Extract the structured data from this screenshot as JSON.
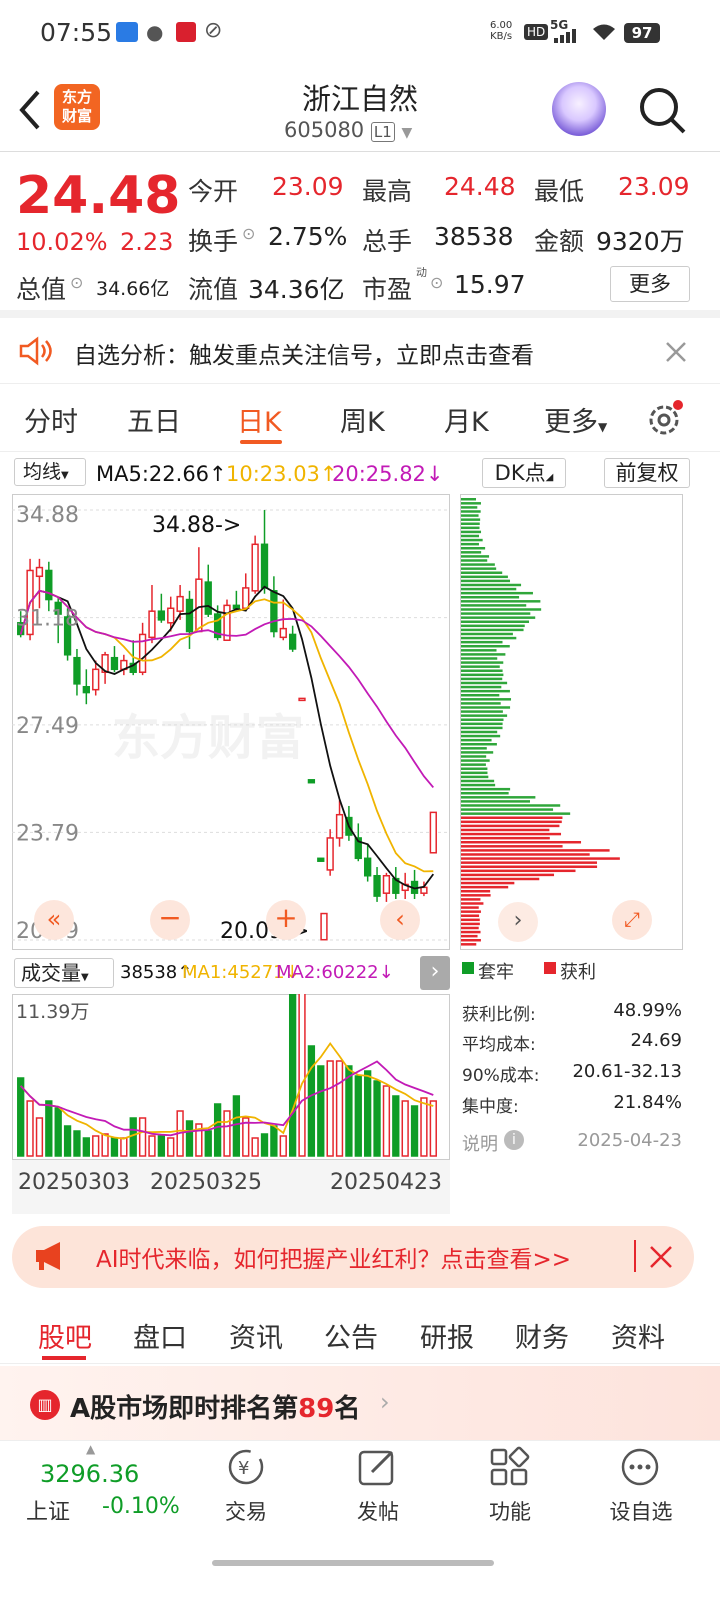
{
  "status": {
    "time": "07:55",
    "speed": "6.00",
    "speed_unit": "KB/s",
    "hd": "HD",
    "net": "5G",
    "battery": "97"
  },
  "header": {
    "title": "浙江自然",
    "code": "605080",
    "level": "L1",
    "logo_line1": "东方",
    "logo_line2": "财富"
  },
  "quote": {
    "price": "24.48",
    "change_pct": "10.02%",
    "change": "2.23",
    "open_label": "今开",
    "open": "23.09",
    "high_label": "最高",
    "high": "24.48",
    "low_label": "最低",
    "low": "23.09",
    "turnover_label": "换手",
    "turnover": "2.75%",
    "volume_label": "总手",
    "volume": "38538",
    "amount_label": "金额",
    "amount": "9320万",
    "mcap_label": "总值",
    "mcap": "34.66亿",
    "float_label": "流值",
    "float": "34.36亿",
    "pe_label": "市盈",
    "pe_sup": "动",
    "pe": "15.97",
    "more_label": "更多"
  },
  "notice": {
    "text": "自选分析：触发重点关注信号，立即点击查看"
  },
  "periods": [
    "分时",
    "五日",
    "日K",
    "周K",
    "月K",
    "更多"
  ],
  "chart_toolbar": {
    "ma_select": "均线",
    "ma5": "MA5:22.66↑",
    "ma10": "10:23.03↑",
    "ma20": "20:25.82↓",
    "dk": "DK点",
    "fq": "前复权"
  },
  "chart_data": {
    "type": "candlestick",
    "y_ticks": [
      "34.88",
      "31.18",
      "27.49",
      "23.79",
      "20.09"
    ],
    "ylim": [
      20.09,
      34.88
    ],
    "high_note": "34.88->",
    "low_note": "20.09->",
    "candles": [
      [
        31.0,
        30.6,
        31.4,
        30.5
      ],
      [
        30.6,
        32.8,
        33.2,
        30.4
      ],
      [
        32.6,
        32.9,
        33.2,
        31.5
      ],
      [
        32.8,
        31.8,
        33.1,
        31.4
      ],
      [
        31.7,
        31.3,
        31.9,
        30.3
      ],
      [
        31.2,
        29.9,
        31.5,
        29.7
      ],
      [
        29.8,
        28.9,
        30.1,
        28.5
      ],
      [
        28.8,
        28.6,
        29.4,
        28.2
      ],
      [
        28.7,
        29.4,
        29.7,
        28.5
      ],
      [
        29.3,
        29.9,
        30.0,
        28.9
      ],
      [
        29.8,
        29.4,
        30.2,
        29.3
      ],
      [
        29.4,
        29.7,
        29.9,
        29.2
      ],
      [
        29.6,
        29.3,
        30.4,
        29.2
      ],
      [
        29.3,
        30.6,
        31.0,
        29.2
      ],
      [
        30.5,
        31.4,
        32.3,
        30.3
      ],
      [
        31.4,
        31.1,
        32.0,
        31.0
      ],
      [
        31.0,
        31.5,
        31.9,
        30.7
      ],
      [
        31.4,
        31.9,
        32.3,
        31.1
      ],
      [
        31.8,
        30.7,
        32.1,
        30.1
      ],
      [
        30.7,
        32.5,
        33.6,
        30.7
      ],
      [
        32.4,
        31.3,
        33.0,
        31.2
      ],
      [
        31.3,
        30.5,
        31.6,
        30.4
      ],
      [
        30.4,
        31.6,
        31.8,
        30.4
      ],
      [
        31.6,
        31.5,
        32.1,
        31.4
      ],
      [
        31.5,
        32.2,
        32.7,
        31.4
      ],
      [
        32.1,
        33.7,
        34.0,
        32.0
      ],
      [
        33.7,
        32.2,
        34.88,
        32.0
      ],
      [
        32.1,
        30.7,
        32.6,
        30.5
      ],
      [
        30.5,
        30.8,
        31.8,
        30.4
      ],
      [
        30.6,
        30.1,
        30.9,
        30.0
      ],
      [
        28.4,
        28.4,
        28.4,
        28.4
      ],
      [
        25.6,
        25.5,
        25.6,
        25.5
      ],
      [
        22.9,
        22.8,
        22.9,
        22.8
      ],
      [
        22.5,
        23.6,
        23.9,
        22.3
      ],
      [
        23.6,
        24.4,
        24.9,
        23.3
      ],
      [
        24.3,
        23.7,
        24.7,
        23.5
      ],
      [
        23.6,
        22.9,
        24.1,
        22.8
      ],
      [
        22.9,
        22.3,
        23.4,
        22.1
      ],
      [
        22.3,
        21.6,
        22.6,
        21.4
      ],
      [
        21.7,
        22.3,
        22.4,
        21.4
      ],
      [
        22.2,
        21.7,
        22.6,
        21.5
      ],
      [
        21.8,
        22.0,
        22.4,
        21.5
      ],
      [
        22.1,
        21.7,
        22.5,
        21.5
      ],
      [
        21.7,
        21.9,
        22.1,
        21.6
      ],
      [
        23.09,
        24.48,
        24.48,
        23.09
      ]
    ],
    "low_candle": [
      20.1,
      21.0,
      21.0,
      20.09
    ]
  },
  "chip": {
    "legend_trapped": "套牢",
    "legend_profit": "获利",
    "profit_ratio_label": "获利比例:",
    "profit_ratio": "48.99%",
    "avg_cost_label": "平均成本:",
    "avg_cost": "24.69",
    "cost90_label": "90%成本:",
    "cost90": "20.61-32.13",
    "concentration_label": "集中度:",
    "concentration": "21.84%",
    "note_label": "说明",
    "date": "2025-04-23"
  },
  "volume_toolbar": {
    "select": "成交量",
    "vol": "38538↑",
    "ma1": "MA1:45271↓",
    "ma2": "MA2:60222↓",
    "max_label": "11.39万"
  },
  "x_dates": [
    "20250303",
    "20250325",
    "20250423"
  ],
  "banner": {
    "text": "AI时代来临，如何把握产业红利？点击查看>>"
  },
  "news_tabs": [
    "股吧",
    "盘口",
    "资讯",
    "公告",
    "研报",
    "财务",
    "资料"
  ],
  "rank": {
    "prefix": "A股市场即时排名第",
    "num": "89",
    "suffix": "名"
  },
  "bottom": {
    "index_value": "3296.36",
    "index_name": "上证",
    "index_change": "-0.10%",
    "trade": "交易",
    "post": "发帖",
    "func": "功能",
    "watch": "设自选"
  },
  "colors": {
    "up": "#e5262d",
    "down": "#0f9d27",
    "accent": "#f15a22",
    "ma5": "#111111",
    "ma10": "#f0b400",
    "ma20": "#c21ab6"
  }
}
